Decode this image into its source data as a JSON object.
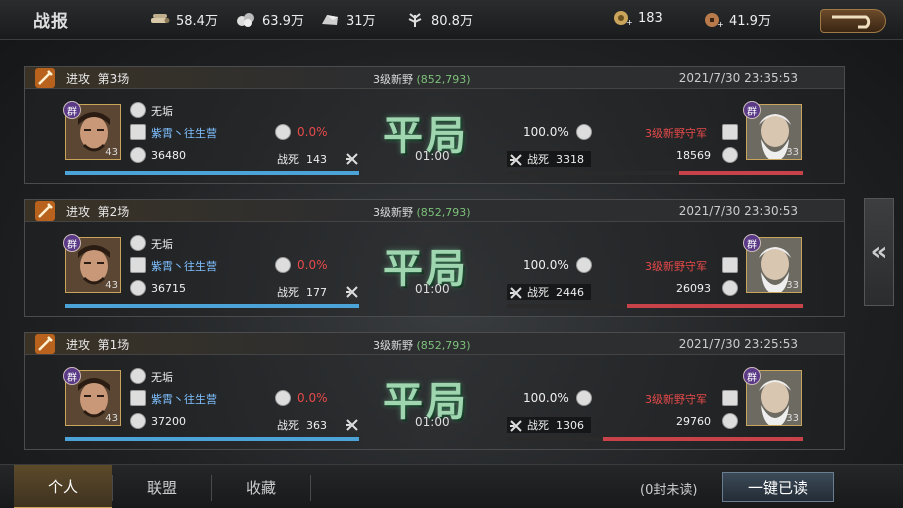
{
  "header": {
    "title": "战报",
    "resources": [
      {
        "icon": "wood-icon",
        "value": "58.4万"
      },
      {
        "icon": "iron-icon",
        "value": "63.9万"
      },
      {
        "icon": "stone-icon",
        "value": "31万"
      },
      {
        "icon": "grain-icon",
        "value": "80.8万"
      }
    ],
    "jade": "183",
    "copper": "41.9万"
  },
  "reports": [
    {
      "type": "进攻",
      "round": "第3场",
      "location": "3级新野",
      "coord": "(852,793)",
      "datetime": "2021/7/30 23:35:53",
      "attacker": {
        "faction": "群",
        "level": "43",
        "name": "无垢",
        "alliance": "紫霄丶往生营",
        "troops": "36480",
        "rate": "0.0%",
        "kills_label": "战死",
        "kills": "143",
        "troop_pct": 1.0
      },
      "result": "平局",
      "duration": "01:00",
      "defender": {
        "faction": "群",
        "level": "33",
        "name": "3级新野守军",
        "troops": "18569",
        "rate": "100.0%",
        "kills_label": "战死",
        "kills": "3318",
        "troop_pct": 0.51
      }
    },
    {
      "type": "进攻",
      "round": "第2场",
      "location": "3级新野",
      "coord": "(852,793)",
      "datetime": "2021/7/30 23:30:53",
      "attacker": {
        "faction": "群",
        "level": "43",
        "name": "无垢",
        "alliance": "紫霄丶往生营",
        "troops": "36715",
        "rate": "0.0%",
        "kills_label": "战死",
        "kills": "177",
        "troop_pct": 1.0
      },
      "result": "平局",
      "duration": "01:00",
      "defender": {
        "faction": "群",
        "level": "33",
        "name": "3级新野守军",
        "troops": "26093",
        "rate": "100.0%",
        "kills_label": "战死",
        "kills": "2446",
        "troop_pct": 0.72
      }
    },
    {
      "type": "进攻",
      "round": "第1场",
      "location": "3级新野",
      "coord": "(852,793)",
      "datetime": "2021/7/30 23:25:53",
      "attacker": {
        "faction": "群",
        "level": "43",
        "name": "无垢",
        "alliance": "紫霄丶往生营",
        "troops": "37200",
        "rate": "0.0%",
        "kills_label": "战死",
        "kills": "363",
        "troop_pct": 1.0
      },
      "result": "平局",
      "duration": "01:00",
      "defender": {
        "faction": "群",
        "level": "33",
        "name": "3级新野守军",
        "troops": "29760",
        "rate": "100.0%",
        "kills_label": "战死",
        "kills": "1306",
        "troop_pct": 0.82
      }
    }
  ],
  "tabs": [
    "个人",
    "联盟",
    "收藏"
  ],
  "unread": "(0封未读)",
  "read_all": "一键已读",
  "colors": {
    "attacker_bar": "#4ca3d8",
    "defender_bar": "#c8424a",
    "draw_text": "#9fd6b0",
    "coord": "#7dc17a"
  }
}
